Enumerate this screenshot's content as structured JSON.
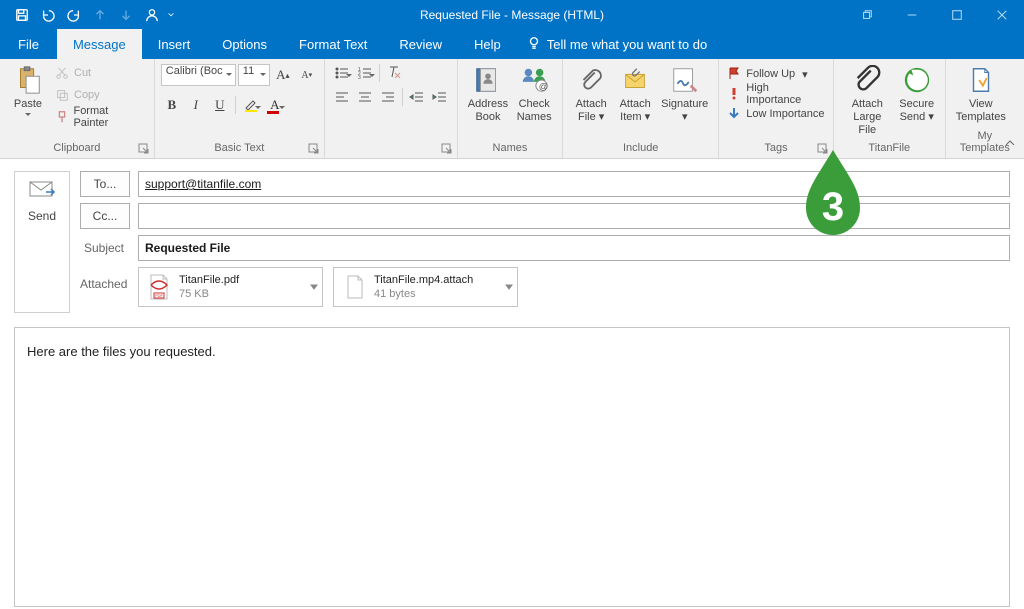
{
  "window": {
    "title": "Requested File  -  Message (HTML)"
  },
  "tabs": {
    "file": "File",
    "message": "Message",
    "insert": "Insert",
    "options": "Options",
    "format": "Format Text",
    "review": "Review",
    "help": "Help",
    "tellme": "Tell me what you want to do"
  },
  "clipboard": {
    "group": "Clipboard",
    "paste": "Paste",
    "cut": "Cut",
    "copy": "Copy",
    "fmt": "Format Painter"
  },
  "basictext": {
    "group": "Basic Text",
    "font": "Calibri (Boc",
    "size": "11"
  },
  "names": {
    "group": "Names",
    "addr1": "Address",
    "addr2": "Book",
    "chk1": "Check",
    "chk2": "Names"
  },
  "include": {
    "group": "Include",
    "af1": "Attach",
    "af2": "File",
    "ai1": "Attach",
    "ai2": "Item",
    "sig": "Signature"
  },
  "tags": {
    "group": "Tags",
    "follow": "Follow Up",
    "high": "High Importance",
    "low": "Low Importance"
  },
  "titan": {
    "group": "TitanFile",
    "al1": "Attach",
    "al2": "Large File",
    "ss1": "Secure",
    "ss2": "Send"
  },
  "mytpl": {
    "group": "My Templates",
    "vt1": "View",
    "vt2": "Templates"
  },
  "compose": {
    "send": "Send",
    "to": "To...",
    "cc": "Cc...",
    "subject_label": "Subject",
    "attached_label": "Attached",
    "to_value": "support@titanfile.com",
    "cc_value": "",
    "subject_value": "Requested File"
  },
  "attachments": [
    {
      "name": "TitanFile.pdf",
      "size": "75 KB",
      "kind": "pdf"
    },
    {
      "name": "TitanFile.mp4.attach",
      "size": "41 bytes",
      "kind": "file"
    }
  ],
  "body": "Here are the files you requested.",
  "callout": "3"
}
